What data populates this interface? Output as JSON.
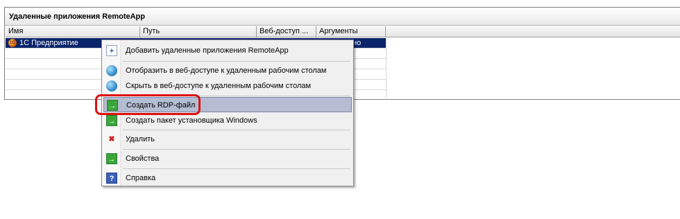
{
  "panel": {
    "title": "Удаленные приложения RemoteApp"
  },
  "columns": [
    {
      "label": "Имя"
    },
    {
      "label": "Путь"
    },
    {
      "label": "Веб-доступ ..."
    },
    {
      "label": "Аргументы"
    }
  ],
  "rows": [
    {
      "name": "1С Предприятие",
      "icon": "app-1c-icon",
      "args_partial": "но"
    }
  ],
  "context_menu": {
    "items": [
      {
        "label": "Добавить удаленные приложения RemoteApp",
        "icon": "add-app-icon"
      },
      {
        "label": "Отобразить в веб-доступе к удаленным рабочим столам",
        "icon": "globe-show-icon"
      },
      {
        "label": "Скрыть в веб-доступе к удаленным рабочим столам",
        "icon": "globe-hide-icon"
      },
      {
        "label": "Создать RDP-файл",
        "icon": "rdp-file-icon",
        "highlighted": true
      },
      {
        "label": "Создать пакет установщика Windows",
        "icon": "msi-package-icon"
      },
      {
        "label": "Удалить",
        "icon": "delete-icon"
      },
      {
        "label": "Свойства",
        "icon": "properties-icon"
      },
      {
        "label": "Справка",
        "icon": "help-icon"
      }
    ]
  },
  "colors": {
    "selection": "#0a246a",
    "menu_highlight": "#b6bdd2",
    "annotation_ring": "#e01010"
  }
}
